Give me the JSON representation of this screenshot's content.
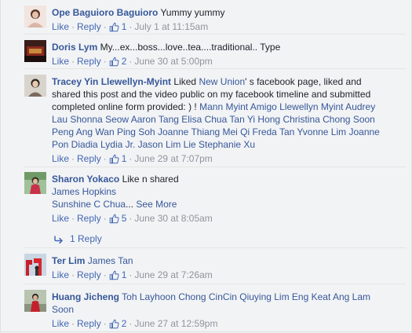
{
  "comments": [
    {
      "author": "Ope Baguioro Baguioro",
      "text": "Yummy yummy",
      "actions": {
        "like": "Like",
        "reply": "Reply",
        "likes": "1",
        "time": "July 1 at 11:15am"
      }
    },
    {
      "author": "Doris Lym",
      "text": "My...ex...boss...love..tea....traditional.. Type",
      "actions": {
        "like": "Like",
        "reply": "Reply",
        "likes": "2",
        "time": "June 30 at 5:00pm"
      }
    },
    {
      "author": "Tracey Yin Llewellyn-Myint",
      "text_before": "Liked",
      "page_link": "New Union",
      "text_after": "' s facebook page, liked and shared this post and the video public on my facebook timeline and submitted completed online form provided: ) !",
      "tags": "Mann Myint Amigo Llewellyn Myint Audrey Lau Shonna Seow Aaron Tang Elisa Chua Tan Yi Hong Christina Chong Soon Peng Ang Wan Ping Soh Joanne Thiang Mei Qi Freda Tan Yvonne Lim Joanne Pon Diadia Lydia Jr. Jason Lim Lie Stephanie Xu",
      "actions": {
        "like": "Like",
        "reply": "Reply",
        "likes": "1",
        "time": "June 29 at 7:07pm"
      }
    },
    {
      "author": "Sharon Yokaco",
      "text": "Like n shared",
      "tag1": "James Hopkins",
      "tag2": "Sunshine C Chua",
      "ellipsis": "...",
      "see_more": "See More",
      "actions": {
        "like": "Like",
        "reply": "Reply",
        "likes": "5",
        "time": "June 30 at 8:05am"
      },
      "replies": "1 Reply"
    },
    {
      "author": "Ter Lim",
      "tags": "James Tan",
      "actions": {
        "like": "Like",
        "reply": "Reply",
        "likes": "1",
        "time": "June 29 at 7:26am"
      }
    },
    {
      "author": "Huang Jicheng",
      "tags": "Toh Layhoon Chong CinCin Qiuying Lim Eng Keat Ang Lam Soon",
      "actions": {
        "like": "Like",
        "reply": "Reply",
        "likes": "2",
        "time": "June 27 at 12:59pm"
      }
    }
  ],
  "dot": "·",
  "colors": {
    "link": "#365899",
    "action": "#4267b2",
    "meta": "#90949c",
    "background": "#f2f3f5"
  }
}
